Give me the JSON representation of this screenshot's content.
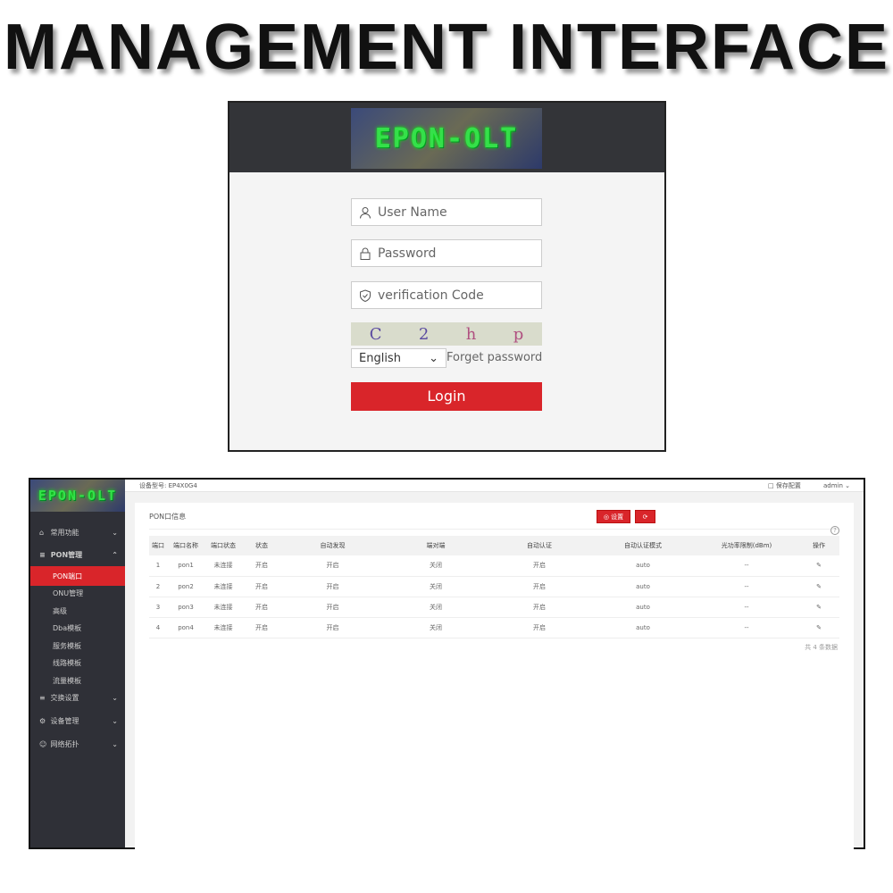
{
  "banner": {
    "title": "MANAGEMENT INTERFACE"
  },
  "login": {
    "logo": "EPON-OLT",
    "username_placeholder": "User Name",
    "password_placeholder": "Password",
    "code_placeholder": "verification Code",
    "captcha": [
      "C",
      "2",
      "h",
      "p"
    ],
    "language": "English",
    "forget": "Forget password",
    "login_label": "Login"
  },
  "admin": {
    "logo": "EPON-OLT",
    "device_model": "设备型号: EP4X0G4",
    "save_config": "保存配置",
    "user": "admin",
    "sidebar": [
      {
        "label": "常用功能",
        "icon": "home-icon",
        "expandable": true
      },
      {
        "label": "PON管理",
        "icon": "sliders-icon",
        "expandable": true,
        "expanded": true
      },
      {
        "label": "PON端口",
        "sub": true,
        "active": true
      },
      {
        "label": "ONU管理",
        "sub": true
      },
      {
        "label": "高级",
        "sub": true
      },
      {
        "label": "Dba模板",
        "sub": true
      },
      {
        "label": "服务模板",
        "sub": true
      },
      {
        "label": "线路模板",
        "sub": true
      },
      {
        "label": "流量模板",
        "sub": true
      },
      {
        "label": "交换设置",
        "icon": "sliders-icon",
        "expandable": true
      },
      {
        "label": "设备管理",
        "icon": "gear-icon",
        "expandable": true
      },
      {
        "label": "网络拓扑",
        "icon": "user-icon",
        "expandable": true
      }
    ],
    "card_title": "PON口信息",
    "settings_button": "设置",
    "columns": [
      "端口",
      "端口名称",
      "端口状态",
      "状态",
      "自动发现",
      "端对端",
      "自动认证",
      "自动认证模式",
      "光功率限制(dBm)",
      "操作"
    ],
    "rows": [
      [
        "1",
        "pon1",
        "未连接",
        "开启",
        "开启",
        "关闭",
        "开启",
        "auto",
        "--"
      ],
      [
        "2",
        "pon2",
        "未连接",
        "开启",
        "开启",
        "关闭",
        "开启",
        "auto",
        "--"
      ],
      [
        "3",
        "pon3",
        "未连接",
        "开启",
        "开启",
        "关闭",
        "开启",
        "auto",
        "--"
      ],
      [
        "4",
        "pon4",
        "未连接",
        "开启",
        "开启",
        "关闭",
        "开启",
        "auto",
        "--"
      ]
    ],
    "total": "共 4 条数据",
    "accent": "#d9252a"
  }
}
